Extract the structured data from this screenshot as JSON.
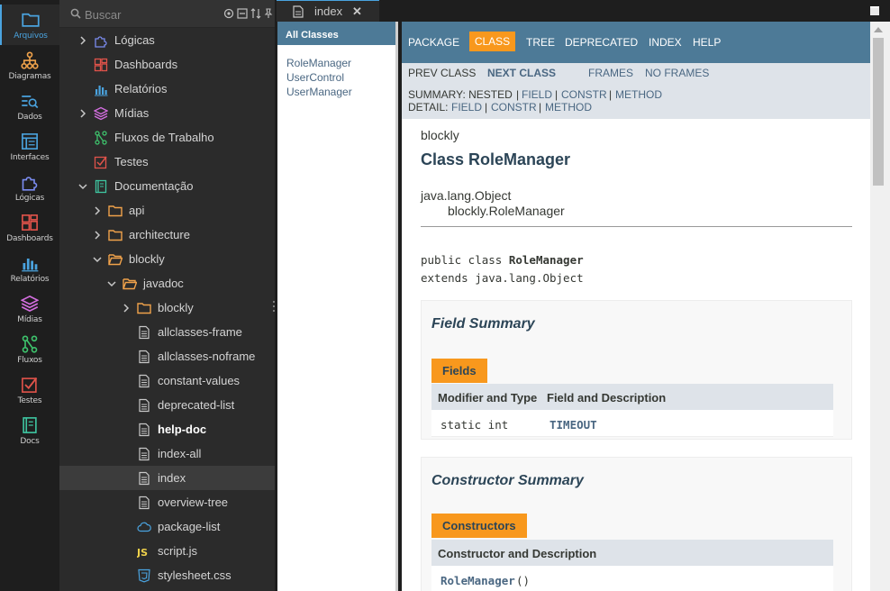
{
  "activity": [
    {
      "label": "Arquivos",
      "icon": "folder-icon",
      "color": "#4aa3df",
      "active": true
    },
    {
      "label": "Diagramas",
      "icon": "diagram-icon",
      "color": "#f0a24b"
    },
    {
      "label": "Dados",
      "icon": "data-search-icon",
      "color": "#4aa3df"
    },
    {
      "label": "Interfaces",
      "icon": "interface-icon",
      "color": "#4aa3df"
    },
    {
      "label": "Lógicas",
      "icon": "puzzle-icon",
      "color": "#7b8cf0"
    },
    {
      "label": "Dashboards",
      "icon": "dashboard-icon",
      "color": "#e0534a"
    },
    {
      "label": "Relatórios",
      "icon": "report-icon",
      "color": "#4aa3df"
    },
    {
      "label": "Mídias",
      "icon": "layers-icon",
      "color": "#d46ee0"
    },
    {
      "label": "Fluxos",
      "icon": "workflow-icon",
      "color": "#3ec46d"
    },
    {
      "label": "Testes",
      "icon": "test-icon",
      "color": "#e0534a"
    },
    {
      "label": "Docs",
      "icon": "docs-icon",
      "color": "#3ec4a0"
    }
  ],
  "search": {
    "placeholder": "Buscar"
  },
  "tree": [
    {
      "label": "Lógicas",
      "depth": 0,
      "chev": "right",
      "icon": "puzzle-icon",
      "color": "#7b8cf0"
    },
    {
      "label": "Dashboards",
      "depth": 0,
      "chev": "none",
      "icon": "dashboard-icon",
      "color": "#e0534a"
    },
    {
      "label": "Relatórios",
      "depth": 0,
      "chev": "none",
      "icon": "report-icon",
      "color": "#4aa3df"
    },
    {
      "label": "Mídias",
      "depth": 0,
      "chev": "right",
      "icon": "layers-icon",
      "color": "#d46ee0"
    },
    {
      "label": "Fluxos de Trabalho",
      "depth": 0,
      "chev": "none",
      "icon": "workflow-icon",
      "color": "#3ec46d"
    },
    {
      "label": "Testes",
      "depth": 0,
      "chev": "none",
      "icon": "test-icon",
      "color": "#e0534a"
    },
    {
      "label": "Documentação",
      "depth": 0,
      "chev": "down",
      "icon": "docs-icon",
      "color": "#3ec4a0"
    },
    {
      "label": "api",
      "depth": 1,
      "chev": "right",
      "icon": "folder-icon",
      "color": "#f0a24b"
    },
    {
      "label": "architecture",
      "depth": 1,
      "chev": "right",
      "icon": "folder-icon",
      "color": "#f0a24b"
    },
    {
      "label": "blockly",
      "depth": 1,
      "chev": "down",
      "icon": "folder-open-icon",
      "color": "#f0a24b"
    },
    {
      "label": "javadoc",
      "depth": 2,
      "chev": "down",
      "icon": "folder-open-icon",
      "color": "#f0a24b"
    },
    {
      "label": "blockly",
      "depth": 3,
      "chev": "right",
      "icon": "folder-icon",
      "color": "#f0a24b"
    },
    {
      "label": "allclasses-frame",
      "depth": 3,
      "chev": "none",
      "icon": "file-icon",
      "color": "#c8c8c8"
    },
    {
      "label": "allclasses-noframe",
      "depth": 3,
      "chev": "none",
      "icon": "file-icon",
      "color": "#c8c8c8"
    },
    {
      "label": "constant-values",
      "depth": 3,
      "chev": "none",
      "icon": "file-icon",
      "color": "#c8c8c8"
    },
    {
      "label": "deprecated-list",
      "depth": 3,
      "chev": "none",
      "icon": "file-icon",
      "color": "#c8c8c8"
    },
    {
      "label": "help-doc",
      "depth": 3,
      "chev": "none",
      "icon": "file-icon",
      "color": "#c8c8c8",
      "bold": true
    },
    {
      "label": "index-all",
      "depth": 3,
      "chev": "none",
      "icon": "file-icon",
      "color": "#c8c8c8"
    },
    {
      "label": "index",
      "depth": 3,
      "chev": "none",
      "icon": "file-icon",
      "color": "#c8c8c8",
      "selected": true
    },
    {
      "label": "overview-tree",
      "depth": 3,
      "chev": "none",
      "icon": "file-icon",
      "color": "#c8c8c8"
    },
    {
      "label": "package-list",
      "depth": 3,
      "chev": "none",
      "icon": "cloud-icon",
      "color": "#4aa3df"
    },
    {
      "label": "script.js",
      "depth": 3,
      "chev": "none",
      "icon": "js-icon",
      "color": "#f0d24b"
    },
    {
      "label": "stylesheet.css",
      "depth": 3,
      "chev": "none",
      "icon": "css-icon",
      "color": "#4aa3df"
    }
  ],
  "tab": {
    "label": "index",
    "close": "✕"
  },
  "classframe": {
    "header": "All Classes",
    "classes": [
      "RoleManager",
      "UserControl",
      "UserManager"
    ]
  },
  "doc": {
    "nav": {
      "package": "PACKAGE",
      "class": "CLASS",
      "tree": "TREE",
      "deprecated": "DEPRECATED",
      "index": "INDEX",
      "help": "HELP"
    },
    "subnav": {
      "prev_class": "PREV CLASS",
      "next_class": "NEXT CLASS",
      "frames": "FRAMES",
      "no_frames": "NO FRAMES",
      "summary_label": "SUMMARY: NESTED",
      "summary_field": "FIELD",
      "summary_constr": "CONSTR",
      "summary_method": "METHOD",
      "detail_label": "DETAIL:",
      "detail_field": "FIELD",
      "detail_constr": "CONSTR",
      "detail_method": "METHOD",
      "sep": "|"
    },
    "package": "blockly",
    "title": "Class RoleManager",
    "inheritance": [
      "java.lang.Object",
      "blockly.RoleManager"
    ],
    "signature_line1_prefix": "public class ",
    "signature_class": "RoleManager",
    "signature_line2": "extends java.lang.Object",
    "field_summary": {
      "title": "Field Summary",
      "caption": "Fields",
      "col1": "Modifier and Type",
      "col2": "Field and Description",
      "row_type": "static int",
      "row_name": "TIMEOUT"
    },
    "constructor_summary": {
      "title": "Constructor Summary",
      "caption": "Constructors",
      "col1": "Constructor and Description",
      "row_name": "RoleManager",
      "row_args": "()"
    }
  }
}
